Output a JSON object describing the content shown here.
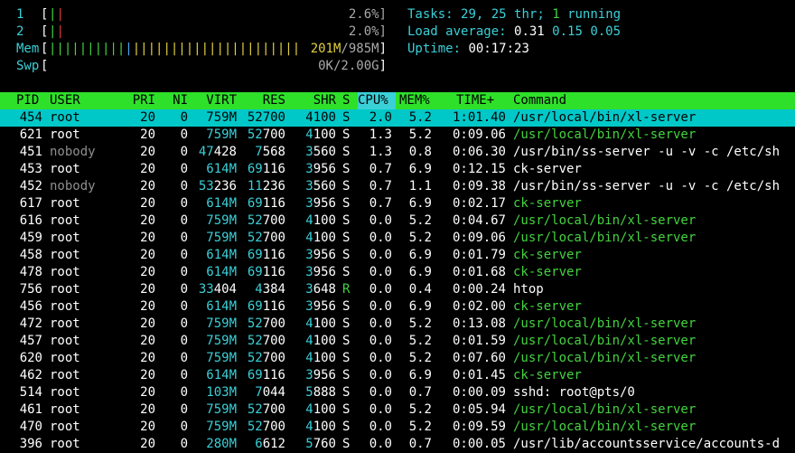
{
  "meters": {
    "cpu1": {
      "label": "1",
      "percent": "2.6%]"
    },
    "cpu2": {
      "label": "2",
      "percent": "2.0%]"
    },
    "mem": {
      "label": "Mem",
      "used": "201M",
      "total": "985M"
    },
    "swp": {
      "label": "Swp",
      "used": "0K",
      "total": "2.00G"
    }
  },
  "summary": {
    "tasks_label": "Tasks:",
    "tasks_value": "29,",
    "threads_value": "25",
    "threads_label": "thr;",
    "running_value": "1",
    "running_label": "running",
    "load_label": "Load average:",
    "load1": "0.31",
    "load5": "0.15",
    "load15": "0.05",
    "uptime_label": "Uptime:",
    "uptime_value": "00:17:23"
  },
  "columns": [
    "PID",
    "USER",
    "PRI",
    "NI",
    "VIRT",
    "RES",
    "SHR",
    "S",
    "CPU%",
    "MEM%",
    "TIME+",
    "Command"
  ],
  "sorted_column": "CPU%",
  "processes": [
    {
      "pid": "454",
      "user": "root",
      "pri": "20",
      "ni": "0",
      "virt": "759M",
      "res": "52700",
      "shr": "4100",
      "s": "S",
      "cpu": "2.0",
      "mem": "5.2",
      "time": "1:01.40",
      "cmd": "/usr/local/bin/xl-server",
      "cmdcolor": "white",
      "selected": true
    },
    {
      "pid": "621",
      "user": "root",
      "pri": "20",
      "ni": "0",
      "virt": "759M",
      "res": "52700",
      "shr": "4100",
      "s": "S",
      "cpu": "1.3",
      "mem": "5.2",
      "time": "0:09.06",
      "cmd": "/usr/local/bin/xl-server",
      "cmdcolor": "green"
    },
    {
      "pid": "451",
      "user": "nobody",
      "pri": "20",
      "ni": "0",
      "virt": "47428",
      "res": "7568",
      "shr": "3560",
      "s": "S",
      "cpu": "1.3",
      "mem": "0.8",
      "time": "0:06.30",
      "cmd": "/usr/bin/ss-server -u -v -c /etc/sh",
      "cmdcolor": "white"
    },
    {
      "pid": "453",
      "user": "root",
      "pri": "20",
      "ni": "0",
      "virt": "614M",
      "res": "69116",
      "shr": "3956",
      "s": "S",
      "cpu": "0.7",
      "mem": "6.9",
      "time": "0:12.15",
      "cmd": "ck-server",
      "cmdcolor": "white"
    },
    {
      "pid": "452",
      "user": "nobody",
      "pri": "20",
      "ni": "0",
      "virt": "53236",
      "res": "11236",
      "shr": "3560",
      "s": "S",
      "cpu": "0.7",
      "mem": "1.1",
      "time": "0:09.38",
      "cmd": "/usr/bin/ss-server -u -v -c /etc/sh",
      "cmdcolor": "white"
    },
    {
      "pid": "617",
      "user": "root",
      "pri": "20",
      "ni": "0",
      "virt": "614M",
      "res": "69116",
      "shr": "3956",
      "s": "S",
      "cpu": "0.7",
      "mem": "6.9",
      "time": "0:02.17",
      "cmd": "ck-server",
      "cmdcolor": "green"
    },
    {
      "pid": "616",
      "user": "root",
      "pri": "20",
      "ni": "0",
      "virt": "759M",
      "res": "52700",
      "shr": "4100",
      "s": "S",
      "cpu": "0.0",
      "mem": "5.2",
      "time": "0:04.67",
      "cmd": "/usr/local/bin/xl-server",
      "cmdcolor": "green"
    },
    {
      "pid": "459",
      "user": "root",
      "pri": "20",
      "ni": "0",
      "virt": "759M",
      "res": "52700",
      "shr": "4100",
      "s": "S",
      "cpu": "0.0",
      "mem": "5.2",
      "time": "0:09.06",
      "cmd": "/usr/local/bin/xl-server",
      "cmdcolor": "green"
    },
    {
      "pid": "458",
      "user": "root",
      "pri": "20",
      "ni": "0",
      "virt": "614M",
      "res": "69116",
      "shr": "3956",
      "s": "S",
      "cpu": "0.0",
      "mem": "6.9",
      "time": "0:01.79",
      "cmd": "ck-server",
      "cmdcolor": "green"
    },
    {
      "pid": "478",
      "user": "root",
      "pri": "20",
      "ni": "0",
      "virt": "614M",
      "res": "69116",
      "shr": "3956",
      "s": "S",
      "cpu": "0.0",
      "mem": "6.9",
      "time": "0:01.68",
      "cmd": "ck-server",
      "cmdcolor": "green"
    },
    {
      "pid": "756",
      "user": "root",
      "pri": "20",
      "ni": "0",
      "virt": "33404",
      "res": "4384",
      "shr": "3648",
      "s": "R",
      "cpu": "0.0",
      "mem": "0.4",
      "time": "0:00.24",
      "cmd": "htop",
      "cmdcolor": "white"
    },
    {
      "pid": "456",
      "user": "root",
      "pri": "20",
      "ni": "0",
      "virt": "614M",
      "res": "69116",
      "shr": "3956",
      "s": "S",
      "cpu": "0.0",
      "mem": "6.9",
      "time": "0:02.00",
      "cmd": "ck-server",
      "cmdcolor": "green"
    },
    {
      "pid": "472",
      "user": "root",
      "pri": "20",
      "ni": "0",
      "virt": "759M",
      "res": "52700",
      "shr": "4100",
      "s": "S",
      "cpu": "0.0",
      "mem": "5.2",
      "time": "0:13.08",
      "cmd": "/usr/local/bin/xl-server",
      "cmdcolor": "green"
    },
    {
      "pid": "457",
      "user": "root",
      "pri": "20",
      "ni": "0",
      "virt": "759M",
      "res": "52700",
      "shr": "4100",
      "s": "S",
      "cpu": "0.0",
      "mem": "5.2",
      "time": "0:01.59",
      "cmd": "/usr/local/bin/xl-server",
      "cmdcolor": "green"
    },
    {
      "pid": "620",
      "user": "root",
      "pri": "20",
      "ni": "0",
      "virt": "759M",
      "res": "52700",
      "shr": "4100",
      "s": "S",
      "cpu": "0.0",
      "mem": "5.2",
      "time": "0:07.60",
      "cmd": "/usr/local/bin/xl-server",
      "cmdcolor": "green"
    },
    {
      "pid": "462",
      "user": "root",
      "pri": "20",
      "ni": "0",
      "virt": "614M",
      "res": "69116",
      "shr": "3956",
      "s": "S",
      "cpu": "0.0",
      "mem": "6.9",
      "time": "0:01.45",
      "cmd": "ck-server",
      "cmdcolor": "green"
    },
    {
      "pid": "514",
      "user": "root",
      "pri": "20",
      "ni": "0",
      "virt": "103M",
      "res": "7044",
      "shr": "5888",
      "s": "S",
      "cpu": "0.0",
      "mem": "0.7",
      "time": "0:00.09",
      "cmd": "sshd: root@pts/0",
      "cmdcolor": "white"
    },
    {
      "pid": "461",
      "user": "root",
      "pri": "20",
      "ni": "0",
      "virt": "759M",
      "res": "52700",
      "shr": "4100",
      "s": "S",
      "cpu": "0.0",
      "mem": "5.2",
      "time": "0:05.94",
      "cmd": "/usr/local/bin/xl-server",
      "cmdcolor": "green"
    },
    {
      "pid": "470",
      "user": "root",
      "pri": "20",
      "ni": "0",
      "virt": "759M",
      "res": "52700",
      "shr": "4100",
      "s": "S",
      "cpu": "0.0",
      "mem": "5.2",
      "time": "0:09.59",
      "cmd": "/usr/local/bin/xl-server",
      "cmdcolor": "green"
    },
    {
      "pid": "396",
      "user": "root",
      "pri": "20",
      "ni": "0",
      "virt": "280M",
      "res": "6612",
      "shr": "5760",
      "s": "S",
      "cpu": "0.0",
      "mem": "0.7",
      "time": "0:00.05",
      "cmd": "/usr/lib/accountsservice/accounts-d",
      "cmdcolor": "white"
    }
  ]
}
